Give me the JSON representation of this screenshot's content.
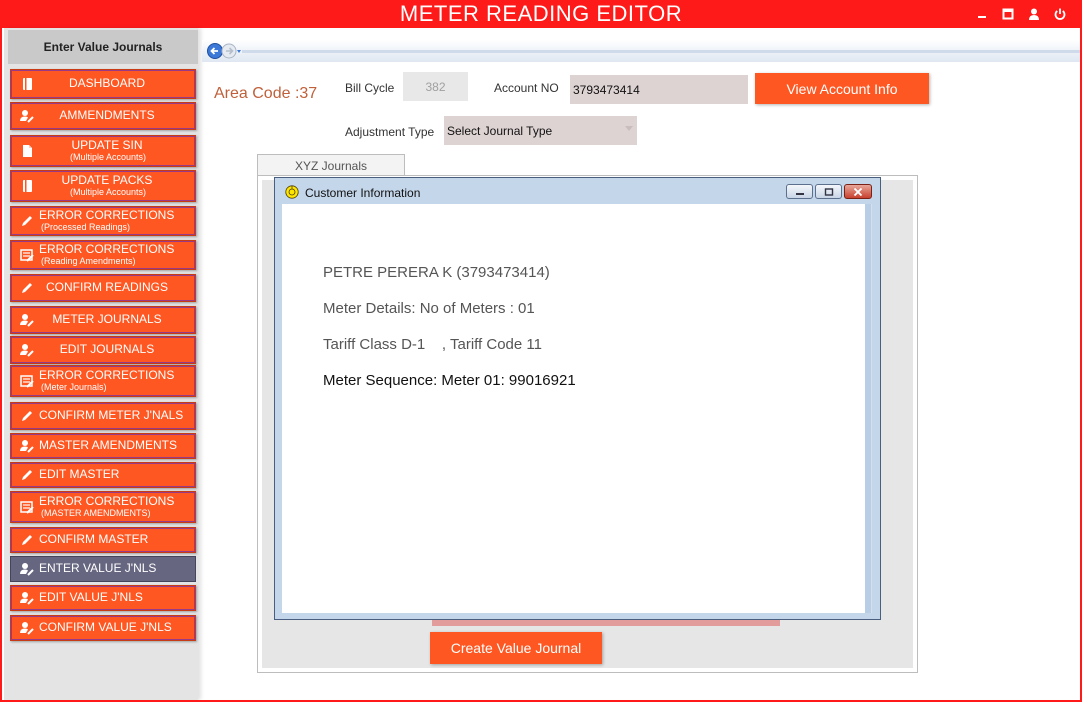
{
  "app": {
    "title": "METER READING EDITOR"
  },
  "sidebar": {
    "header": "Enter Value Journals",
    "items": [
      {
        "label": "DASHBOARD",
        "sub": "",
        "icon": "book-icon"
      },
      {
        "label": "AMMENDMENTS",
        "sub": "",
        "icon": "user-edit-icon"
      },
      {
        "label": "UPDATE SIN",
        "sub": "(Multiple Accounts)",
        "icon": "document-icon"
      },
      {
        "label": "UPDATE PACKS",
        "sub": "(Multiple Accounts)",
        "icon": "book-icon"
      },
      {
        "label": "ERROR CORRECTIONS",
        "sub": "(Processed Readings)",
        "icon": "pencil-icon"
      },
      {
        "label": "ERROR CORRECTIONS",
        "sub": "(Reading Amendments)",
        "icon": "list-edit-icon"
      },
      {
        "label": "CONFIRM READINGS",
        "sub": "",
        "icon": "pencil-icon"
      },
      {
        "label": "METER JOURNALS",
        "sub": "",
        "icon": "user-edit-icon"
      },
      {
        "label": "EDIT JOURNALS",
        "sub": "",
        "icon": "user-edit-icon"
      },
      {
        "label": "ERROR CORRECTIONS",
        "sub": "(Meter Journals)",
        "icon": "list-edit-icon"
      },
      {
        "label": "CONFIRM METER J'NALS",
        "sub": "",
        "icon": "pencil-icon"
      },
      {
        "label": "MASTER AMENDMENTS",
        "sub": "",
        "icon": "user-edit-icon"
      },
      {
        "label": "EDIT MASTER",
        "sub": "",
        "icon": "pencil-icon"
      },
      {
        "label": "ERROR CORRECTIONS",
        "sub": "(MASTER AMENDMENTS)",
        "icon": "list-edit-icon"
      },
      {
        "label": "CONFIRM MASTER",
        "sub": "",
        "icon": "pencil-icon"
      },
      {
        "label": "ENTER VALUE J'NLS",
        "sub": "",
        "icon": "user-edit-icon"
      },
      {
        "label": "EDIT VALUE J'NLS",
        "sub": "",
        "icon": "user-edit-icon"
      },
      {
        "label": "CONFIRM VALUE J'NLS",
        "sub": "",
        "icon": "user-edit-icon"
      }
    ],
    "active_index": 15
  },
  "form": {
    "area_code": "Area Code :37",
    "bill_cycle_label": "Bill Cycle",
    "bill_cycle_value": "382",
    "account_label": "Account NO",
    "account_value": "3793473414",
    "view_button": "View Account Info",
    "adjustment_label": "Adjustment Type",
    "adjustment_value": "Select Journal Type",
    "tab_label": "XYZ Journals",
    "create_button": "Create Value Journal"
  },
  "dialog": {
    "title": "Customer Information",
    "lines": [
      "PETRE PERERA K (3793473414)",
      "Meter Details: No of Meters : 01",
      "Tariff Class D-1    , Tariff Code 11",
      "Meter Sequence: Meter 01: 99016921"
    ]
  },
  "colors": {
    "accent": "#ff5722",
    "title_red": "#ff1a1a",
    "active_item": "#666681"
  }
}
